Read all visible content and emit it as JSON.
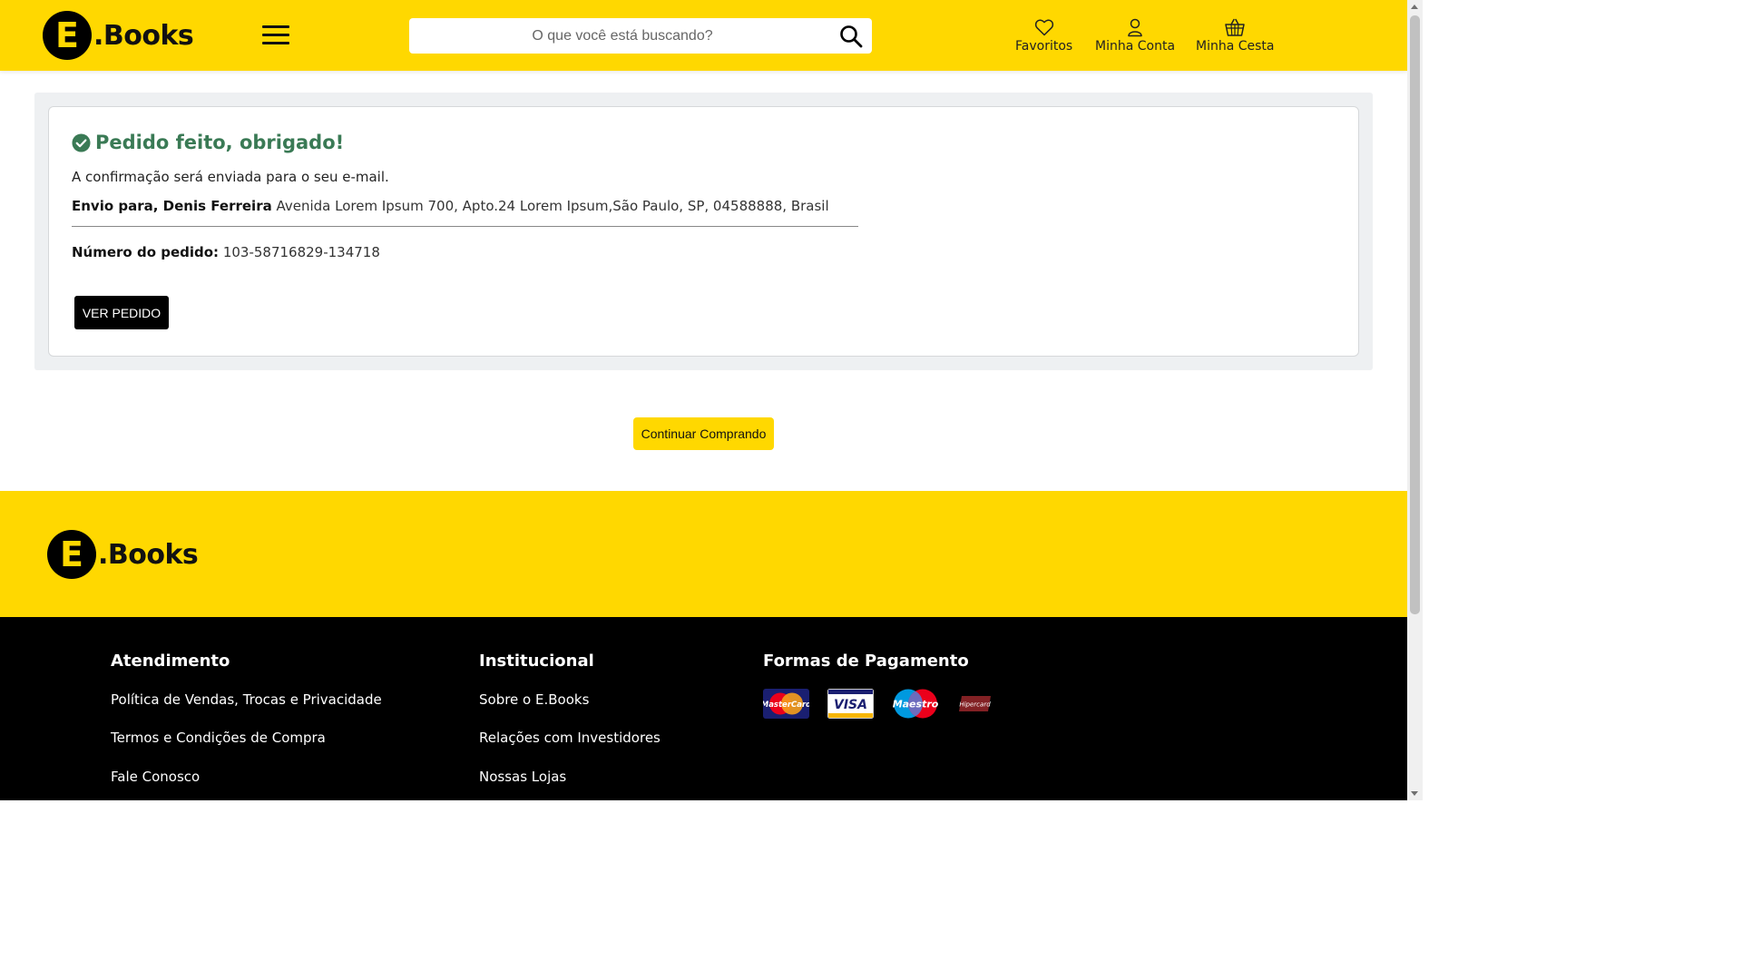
{
  "brand": {
    "logo_letter": "E",
    "logo_text": ".Books",
    "yellow": "#ffd800",
    "green": "#3a7a55"
  },
  "header": {
    "search_placeholder": "O que você está buscando?",
    "favorites_label": "Favoritos",
    "account_label": "Minha Conta",
    "basket_label": "Minha Cesta"
  },
  "order": {
    "title": "Pedido feito, obrigado!",
    "confirmation": "A confirmação será enviada para o seu e-mail.",
    "ship_label": "Envio para, Denis Ferreira",
    "ship_address": " Avenida Lorem Ipsum 700, Apto.24 Lorem Ipsum,São Paulo, SP, 04588888, Brasil",
    "number_label": "Número do pedido:",
    "number_value": " 103-58716829-134718",
    "view_button": "VER PEDIDO"
  },
  "continue_button": "Continuar Comprando",
  "footer": {
    "atendimento": {
      "heading": "Atendimento",
      "links": [
        "Política de Vendas, Trocas e Privacidade",
        "Termos e Condições de Compra",
        "Fale Conosco"
      ]
    },
    "institucional": {
      "heading": "Institucional",
      "links": [
        "Sobre o E.Books",
        "Relações com Investidores",
        "Nossas Lojas"
      ]
    },
    "pagamento": {
      "heading": "Formas de Pagamento",
      "cards": [
        "MasterCard",
        "VISA",
        "Maestro",
        "Hipercard"
      ]
    }
  }
}
